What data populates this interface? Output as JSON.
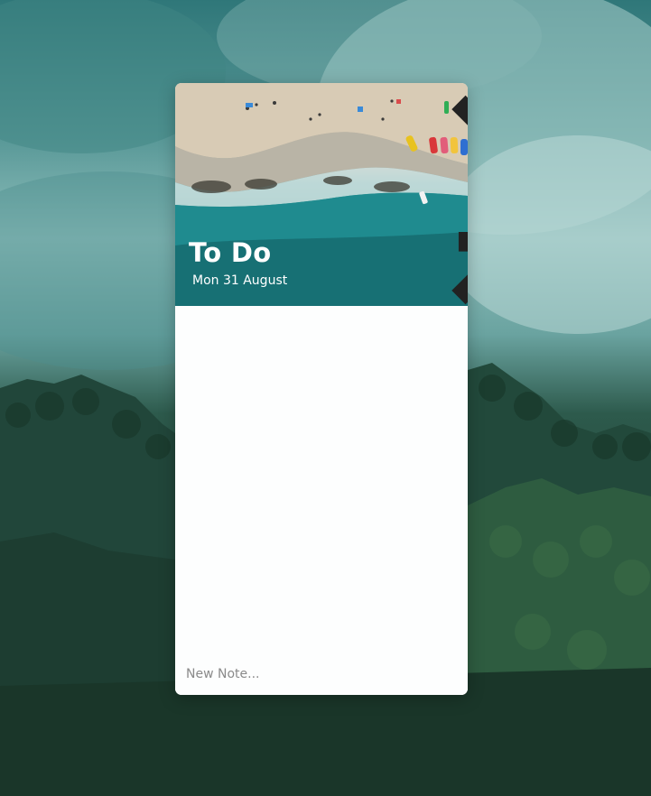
{
  "window": {
    "title": "To Do",
    "date": "Mon 31 August",
    "minimize_icon": "minimize-icon",
    "close_icon": "close-icon"
  },
  "notes": [],
  "new_note": {
    "placeholder": "New Note...",
    "value": ""
  },
  "colors": {
    "window_bg": "#ffffff",
    "title_text": "#ffffff",
    "placeholder_text": "#8a8a8a",
    "sea": "#1f8c90",
    "sand": "#cdbfa9"
  }
}
